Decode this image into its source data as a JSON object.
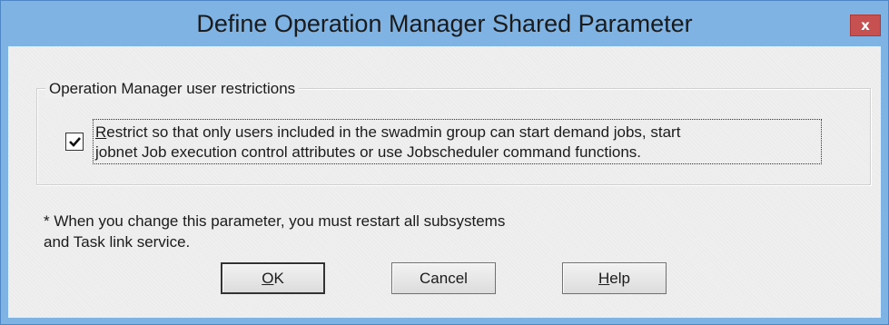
{
  "window": {
    "title": "Define Operation Manager Shared Parameter",
    "close_glyph": "x"
  },
  "groupbox": {
    "legend": "Operation Manager user restrictions",
    "checkbox": {
      "checked": true,
      "label_first_letter": "R",
      "label_line1_rest": "estrict so that only users included in the swadmin group can start demand jobs, start",
      "label_line2": "jobnet Job execution control attributes or use Jobscheduler command functions."
    }
  },
  "note": {
    "line1": "* When you change this parameter, you must restart all subsystems",
    "line2": "and Task link service."
  },
  "buttons": {
    "ok": {
      "first": "O",
      "rest": "K"
    },
    "cancel": {
      "label": "Cancel"
    },
    "help": {
      "first": "H",
      "rest": "elp"
    }
  },
  "colors": {
    "frame": "#7fb3e3",
    "close": "#c75050",
    "client": "#efefef"
  },
  "icons": {
    "close": "close-icon",
    "check": "checkmark-icon"
  }
}
